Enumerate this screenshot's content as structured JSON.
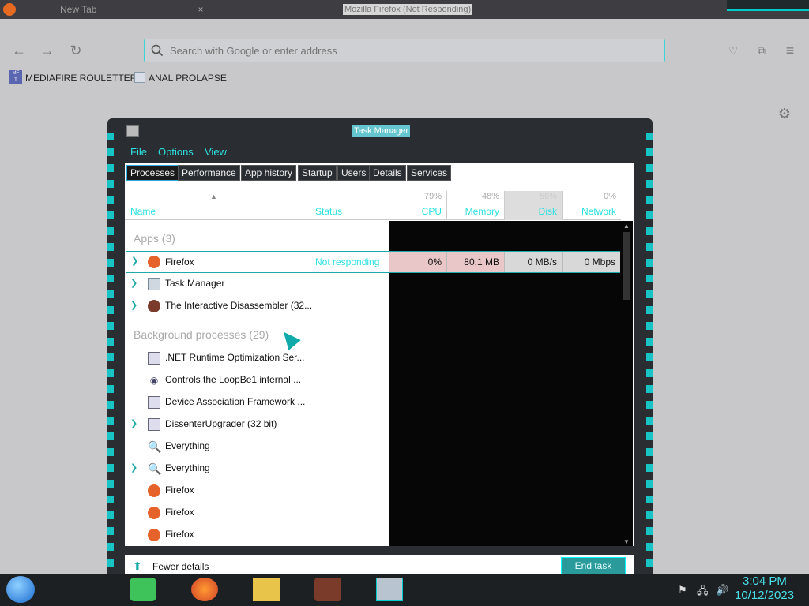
{
  "browser": {
    "tab_title": "New Tab",
    "window_title": "Mozilla Firefox (Not Responding)",
    "url_placeholder": "Search with Google or enter address",
    "bookmarks": [
      "MEDIAFIRE ROULETTER",
      "ANAL PROLAPSE"
    ]
  },
  "taskmanager": {
    "title": "Task Manager",
    "menu": [
      "File",
      "Options",
      "View"
    ],
    "tabs": [
      "Processes",
      "Performance",
      "App history",
      "Startup",
      "Users",
      "Details",
      "Services"
    ],
    "columns": {
      "name": "Name",
      "status": "Status",
      "cpu_pct": "79%",
      "cpu": "CPU",
      "mem_pct": "48%",
      "mem": "Memory",
      "disk_pct": "56%",
      "disk": "Disk",
      "net_pct": "0%",
      "net": "Network"
    },
    "apps_header": "Apps (3)",
    "bg_header": "Background processes (29)",
    "apps": [
      {
        "name": "Firefox",
        "status": "Not responding",
        "cpu": "0%",
        "mem": "80.1 MB",
        "disk": "0 MB/s",
        "net": "0 Mbps"
      },
      {
        "name": "Task Manager"
      },
      {
        "name": "The Interactive Disassembler (32..."
      }
    ],
    "background": [
      ".NET Runtime Optimization Ser...",
      "Controls the LoopBe1 internal ...",
      "Device Association Framework ...",
      "DissenterUpgrader (32 bit)",
      "Everything",
      "Everything",
      "Firefox",
      "Firefox",
      "Firefox"
    ],
    "fewer_details": "Fewer details",
    "end_task": "End task"
  },
  "clock": {
    "time": "3:04 PM",
    "date": "10/12/2023"
  },
  "colors": {
    "accent": "#2ee0e0",
    "panel": "#2a2e32"
  }
}
